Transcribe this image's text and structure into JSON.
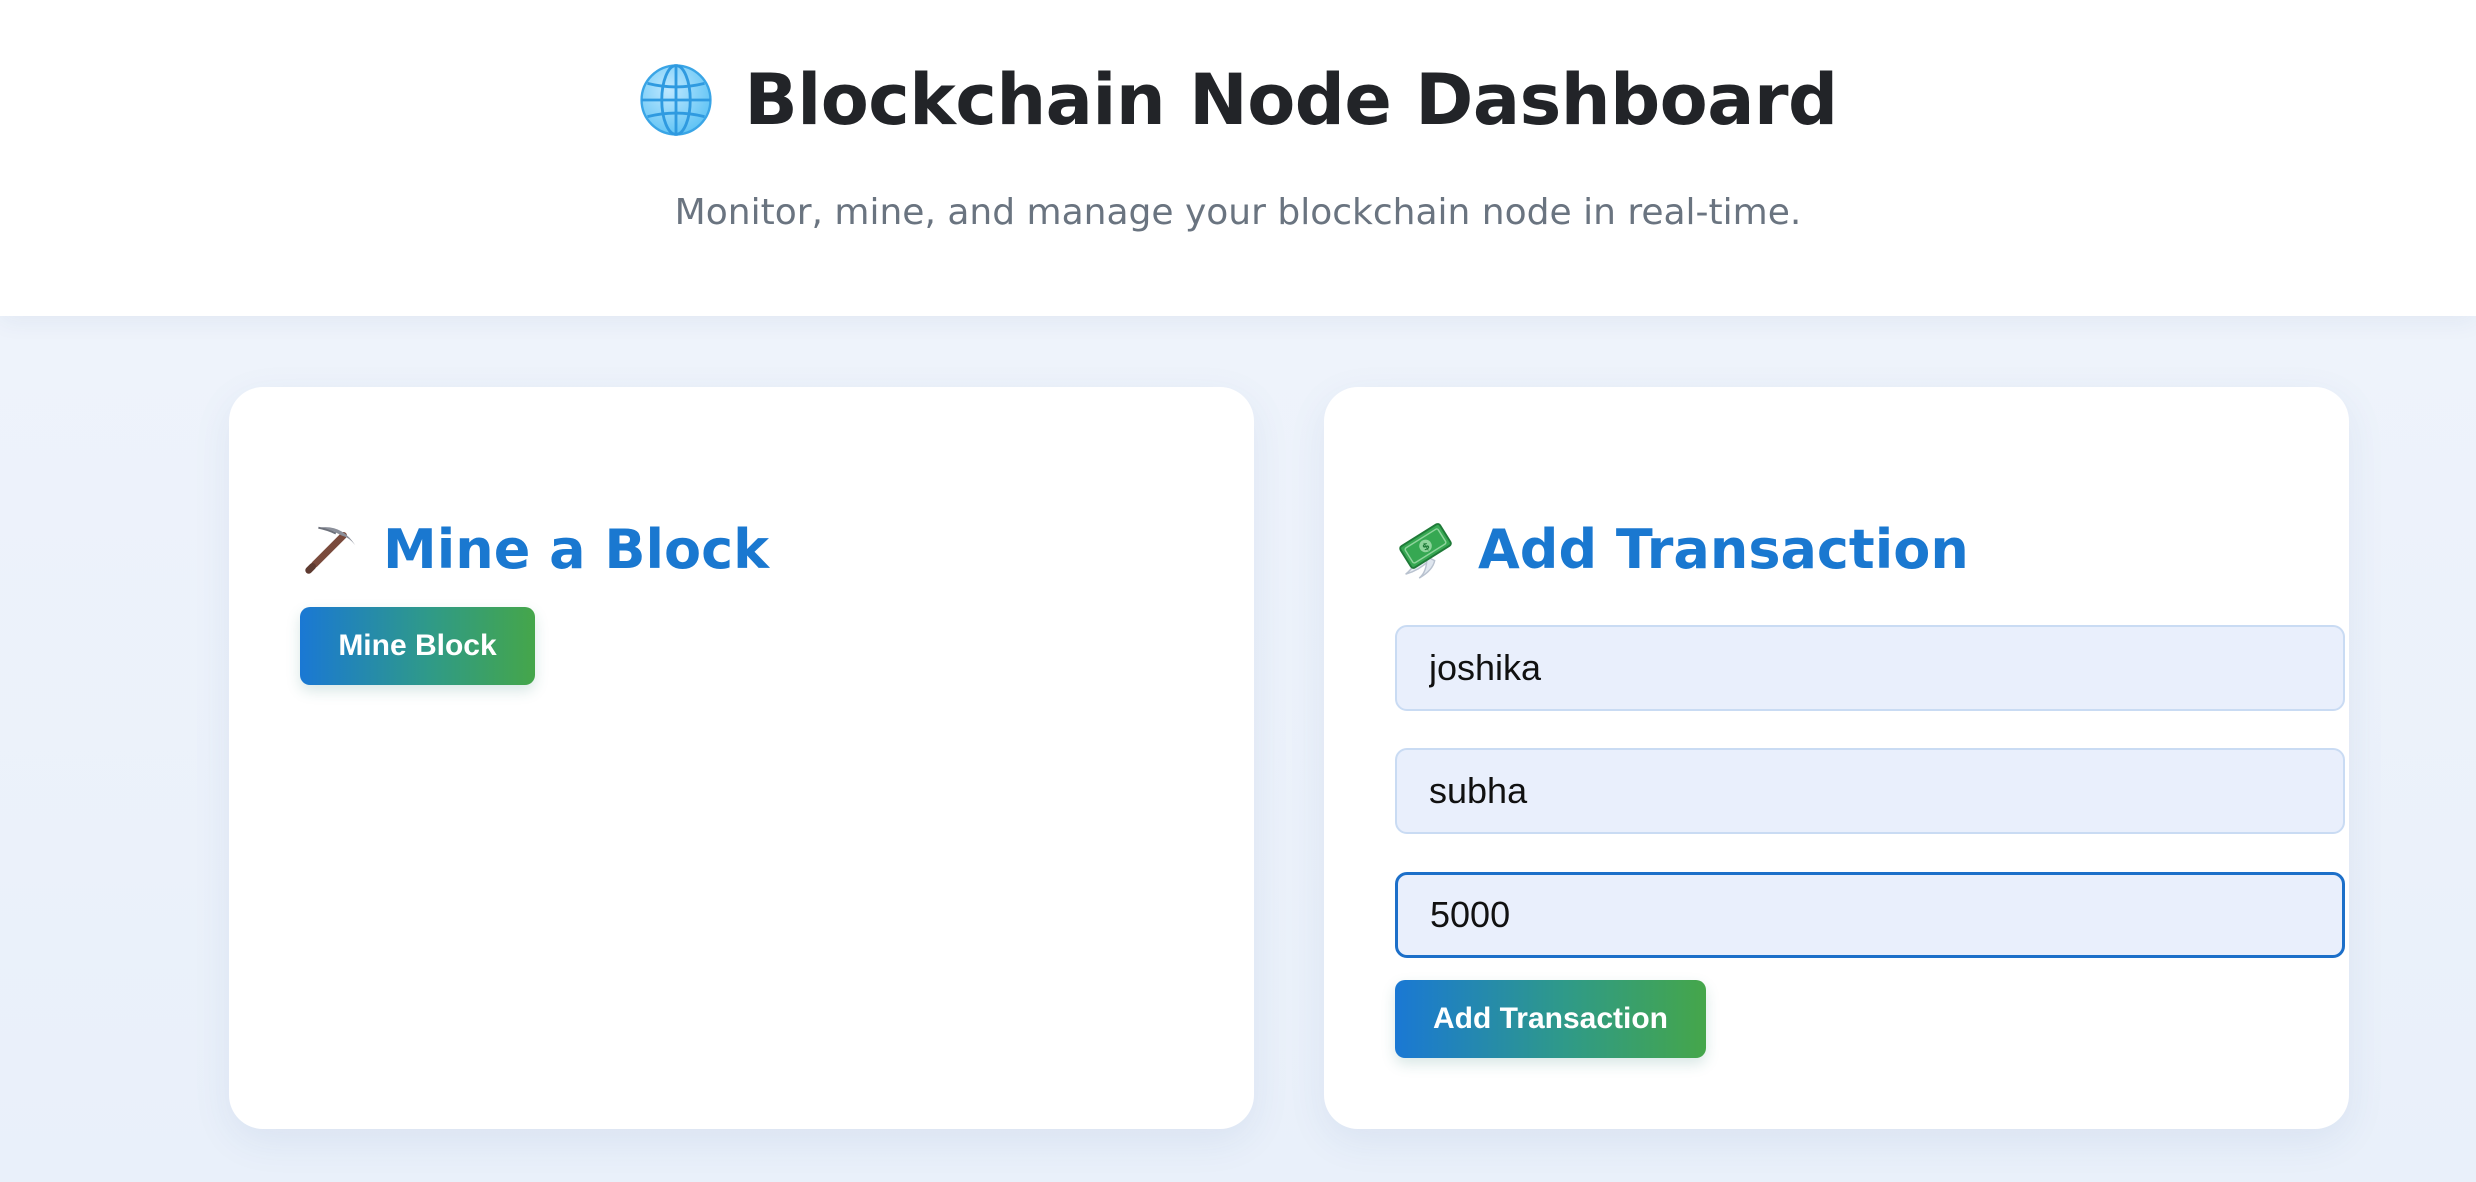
{
  "header": {
    "globe_icon": "globe-icon",
    "title": "Blockchain Node Dashboard",
    "subtitle": "Monitor, mine, and manage your blockchain node in real-time."
  },
  "mine_card": {
    "icon": "pickaxe-icon",
    "title": "Mine a Block",
    "button_label": "Mine Block"
  },
  "transaction_card": {
    "icon": "money-with-wings-icon",
    "title": "Add Transaction",
    "sender_value": "joshika",
    "recipient_value": "subha",
    "amount_value": "5000",
    "button_label": "Add Transaction"
  },
  "colors": {
    "accent_blue": "#1a78d0",
    "button_gradient_start": "#1a78d4",
    "button_gradient_end": "#45a64a",
    "input_background": "#e9effc",
    "focused_border": "#1c6fc9"
  }
}
